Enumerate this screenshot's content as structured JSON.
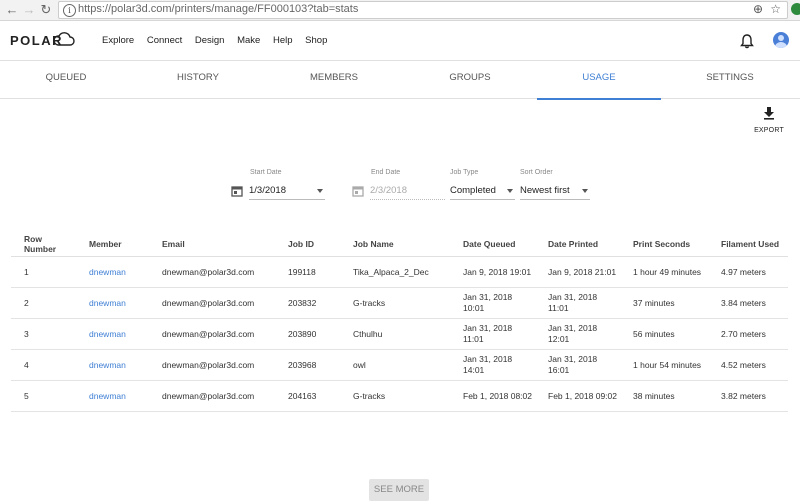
{
  "browser": {
    "url": "https://polar3d.com/printers/manage/FF000103?tab=stats",
    "back_icon": "←",
    "forward_icon": "→",
    "reload_icon": "↻",
    "info_icon": "i",
    "zoom_icon": "⊕",
    "star_icon": "☆"
  },
  "header": {
    "logo": "POLAR",
    "nav": [
      "Explore",
      "Connect",
      "Design",
      "Make",
      "Help",
      "Shop"
    ]
  },
  "tabs": [
    {
      "label": "QUEUED",
      "active": false
    },
    {
      "label": "HISTORY",
      "active": false
    },
    {
      "label": "MEMBERS",
      "active": false
    },
    {
      "label": "GROUPS",
      "active": false
    },
    {
      "label": "USAGE",
      "active": true
    },
    {
      "label": "SETTINGS",
      "active": false
    }
  ],
  "export": {
    "label": "EXPORT",
    "icon": "download-icon"
  },
  "filters": {
    "start_date": {
      "label": "Start Date",
      "value": "1/3/2018"
    },
    "end_date": {
      "label": "End Date",
      "value": "2/3/2018"
    },
    "job_type": {
      "label": "Job Type",
      "value": "Completed"
    },
    "sort_order": {
      "label": "Sort Order",
      "value": "Newest first"
    }
  },
  "table": {
    "columns": [
      "Row Number",
      "Member",
      "Email",
      "Job ID",
      "Job Name",
      "Date Queued",
      "Date Printed",
      "Print Seconds",
      "Filament Used"
    ],
    "rows": [
      [
        "1",
        "dnewman",
        "dnewman@polar3d.com",
        "199118",
        "Tika_Alpaca_2_Dec",
        "Jan 9, 2018 19:01",
        "Jan 9, 2018 21:01",
        "1 hour 49 minutes",
        "4.97 meters"
      ],
      [
        "2",
        "dnewman",
        "dnewman@polar3d.com",
        "203832",
        "G-tracks",
        "Jan 31, 2018 10:01",
        "Jan 31, 2018 11:01",
        "37 minutes",
        "3.84 meters"
      ],
      [
        "3",
        "dnewman",
        "dnewman@polar3d.com",
        "203890",
        "Cthulhu",
        "Jan 31, 2018 11:01",
        "Jan 31, 2018 12:01",
        "56 minutes",
        "2.70 meters"
      ],
      [
        "4",
        "dnewman",
        "dnewman@polar3d.com",
        "203968",
        "owl",
        "Jan 31, 2018 14:01",
        "Jan 31, 2018 16:01",
        "1 hour 54 minutes",
        "4.52 meters"
      ],
      [
        "5",
        "dnewman",
        "dnewman@polar3d.com",
        "204163",
        "G-tracks",
        "Feb 1, 2018 08:02",
        "Feb 1, 2018 09:02",
        "38 minutes",
        "3.82 meters"
      ]
    ]
  },
  "see_more": "SEE MORE",
  "colors": {
    "accent": "#3f7fd4",
    "logo": "#222222",
    "extension": "#2e8b3e"
  }
}
